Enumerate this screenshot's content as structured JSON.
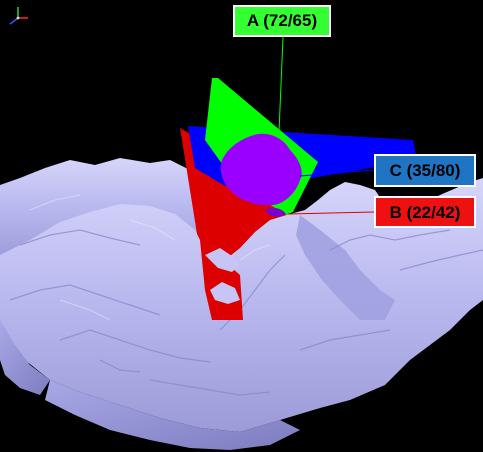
{
  "viewer": {
    "axis_gizmo_icon": "xyz-axes-icon",
    "background_color": "#000000",
    "terrain_color": "#b7b6f0"
  },
  "planes": [
    {
      "id": "A",
      "label": "A (72/65)",
      "color": "#00ff00",
      "box_color": "#33ff33"
    },
    {
      "id": "B",
      "label": "B (22/42)",
      "color": "#ff0000",
      "box_color": "#ee1111"
    },
    {
      "id": "C",
      "label": "C (35/80)",
      "color": "#0000ff",
      "box_color": "#1f74c4"
    }
  ],
  "intersection_color": "#9900ff"
}
